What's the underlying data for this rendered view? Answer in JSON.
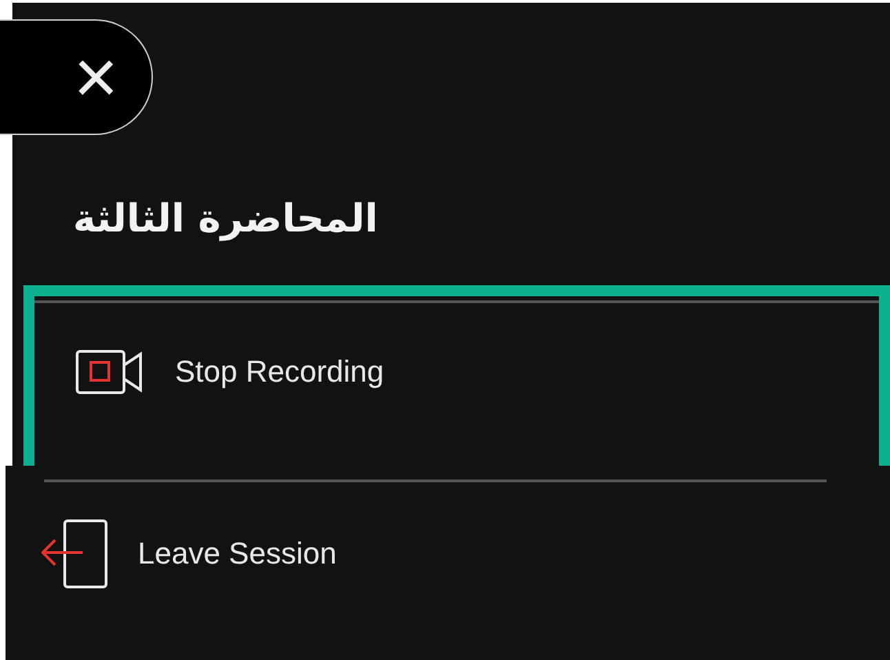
{
  "close_button": {
    "label": "×"
  },
  "title": "المحاضرة الثالثة",
  "menu": [
    {
      "kind": "record",
      "label": "Stop Recording",
      "focused": true
    },
    {
      "kind": "leave",
      "label": "Leave Session",
      "focused": false
    }
  ]
}
